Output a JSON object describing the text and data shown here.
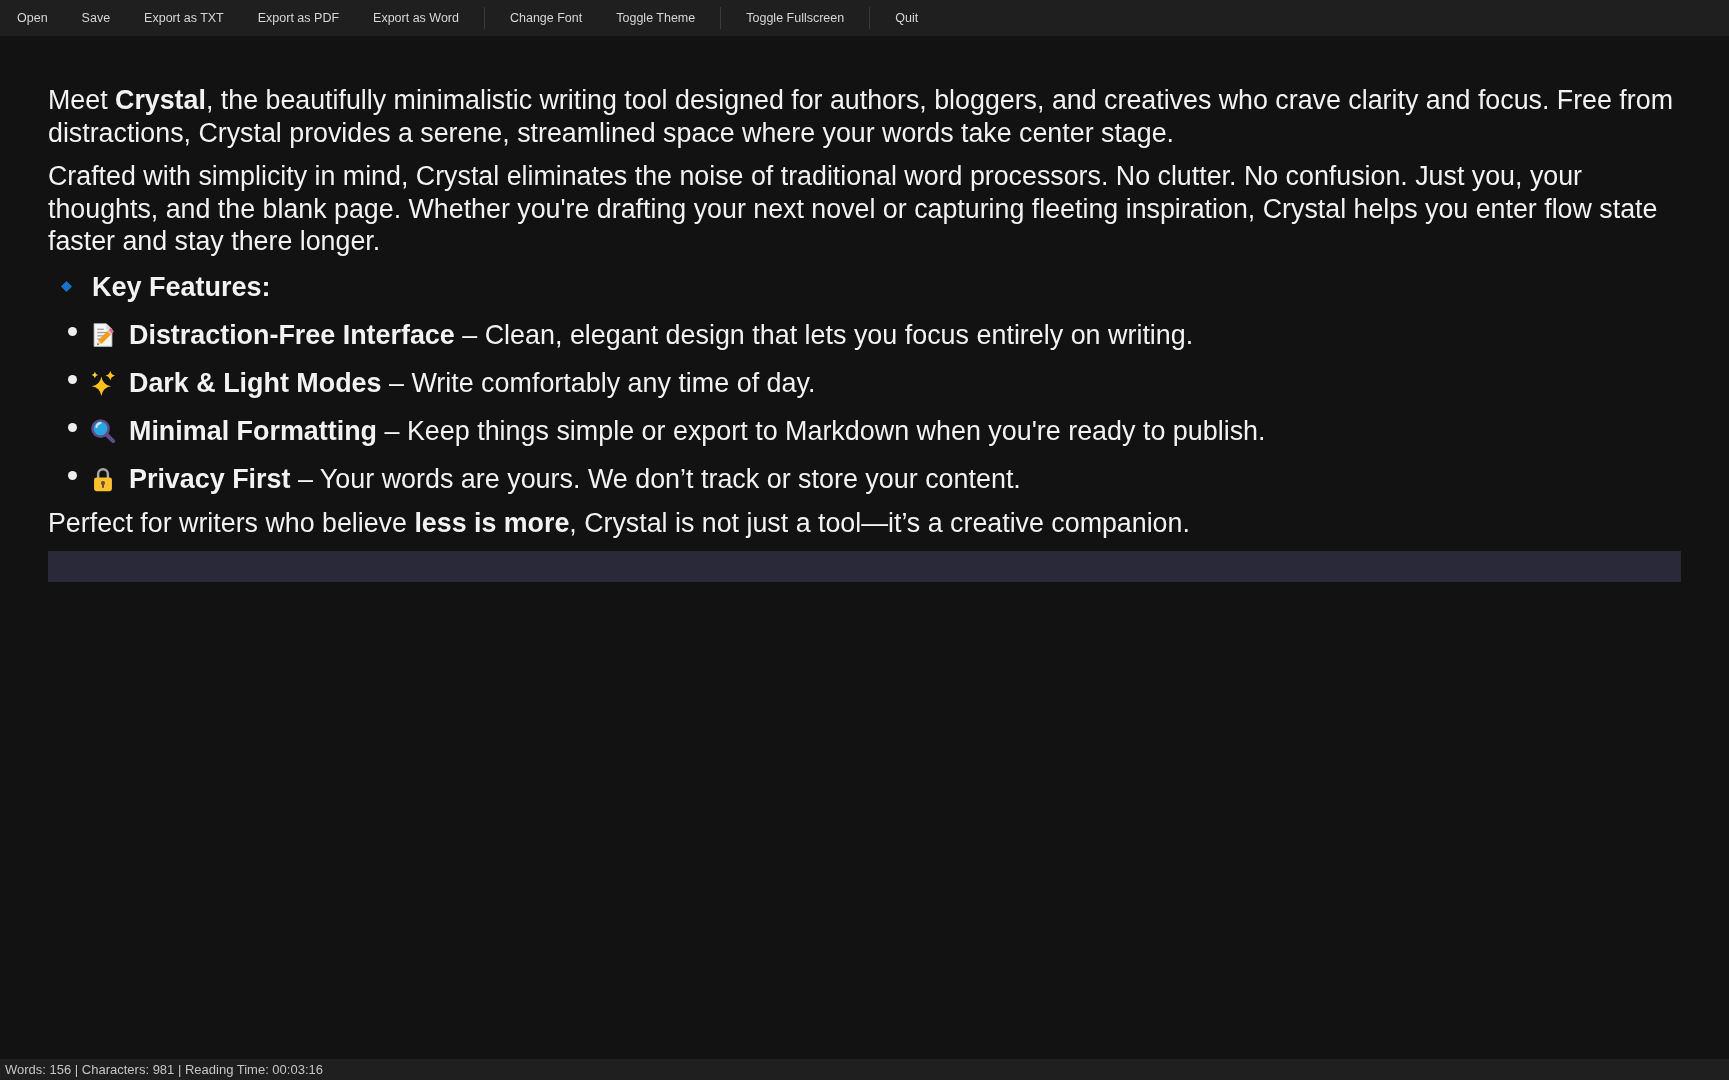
{
  "toolbar": {
    "groups": [
      [
        "Open",
        "Save",
        "Export as TXT",
        "Export as PDF",
        "Export as Word"
      ],
      [
        "Change Font",
        "Toggle Theme"
      ],
      [
        "Toggle Fullscreen"
      ],
      [
        "Quit"
      ]
    ]
  },
  "document": {
    "paragraphs": [
      "Meet **Crystal**, the beautifully minimalistic writing tool designed for authors, bloggers, and creatives who crave clarity and focus. Free from distractions, Crystal provides a serene, streamlined space where your words take center stage.",
      "Crafted with simplicity in mind, Crystal eliminates the noise of traditional word processors. No clutter. No confusion. Just you, your thoughts, and the blank page. Whether you're drafting your next novel or capturing fleeting inspiration, Crystal helps you enter flow state faster and stay there longer."
    ],
    "features_heading": "Key Features:",
    "features": [
      "**Distraction-Free Interface** – Clean, elegant design that lets you focus entirely on writing.",
      "**Dark & Light Modes** – Write comfortably any time of day.",
      "**Minimal Formatting** – Keep things simple or export to Markdown when you're ready to publish.",
      "**Privacy First** – Your words are yours. We don’t track or store your content."
    ],
    "closing": "Perfect for writers who believe **less is more**, Crystal is not just a tool—it’s a creative companion."
  },
  "status_bar": {
    "text": "Words: 156 | Characters: 981 | Reading Time: 00:03:16"
  }
}
